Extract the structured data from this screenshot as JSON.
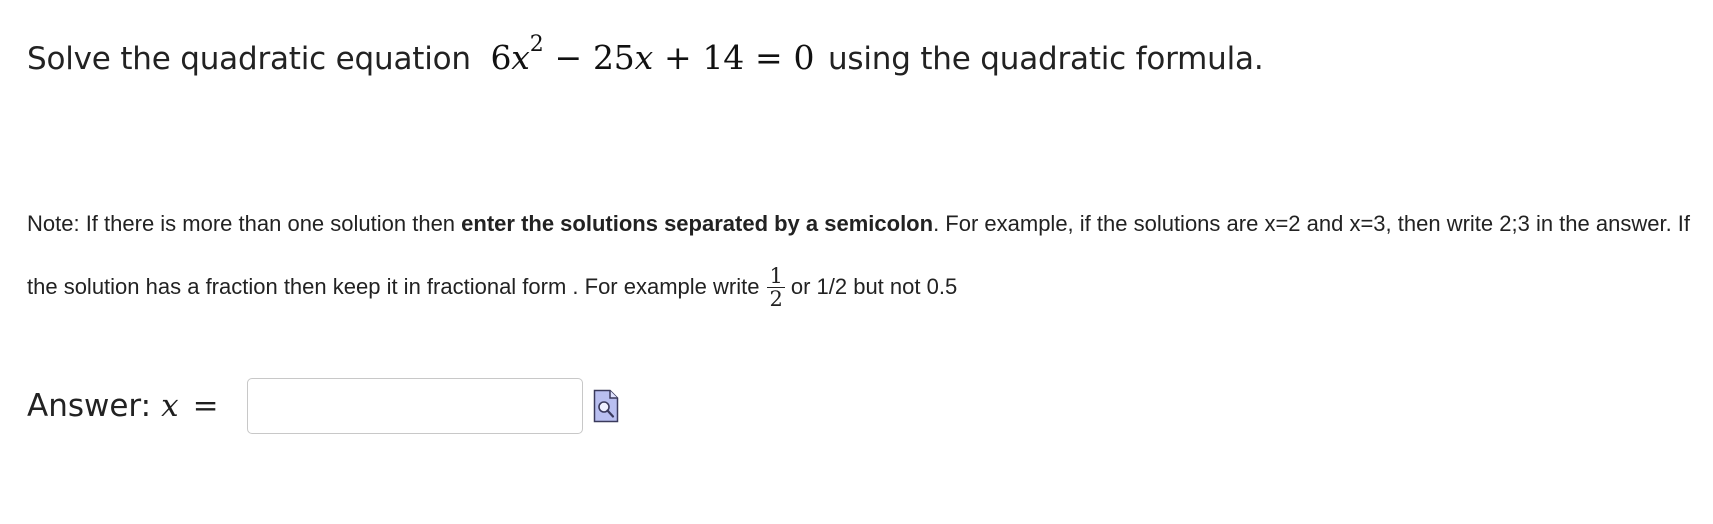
{
  "question": {
    "prefix": "Solve the quadratic equation",
    "equation": {
      "coef_a": "6",
      "variable": "x",
      "exponent": "2",
      "minus": "−",
      "coef_b": "25",
      "plus": "+",
      "constant": "14",
      "equals": "=",
      "rhs": "0"
    },
    "suffix": "using the quadratic formula."
  },
  "note": {
    "part1": "Note: If there is more than one solution then ",
    "bold": "enter the solutions separated by a semicolon",
    "part2": ". For example, if the solutions are x=2 and x=3, then write 2;3 in the answer.  If the solution has a fraction then keep it in fractional form . For example write",
    "frac_num": "1",
    "frac_den": "2",
    "part3": "or 1/2 but not 0.5"
  },
  "answer": {
    "label": "Answer:",
    "variable": "x",
    "equals": "=",
    "value": "",
    "placeholder": ""
  },
  "icons": {
    "preview": "preview-magnifier-icon"
  }
}
